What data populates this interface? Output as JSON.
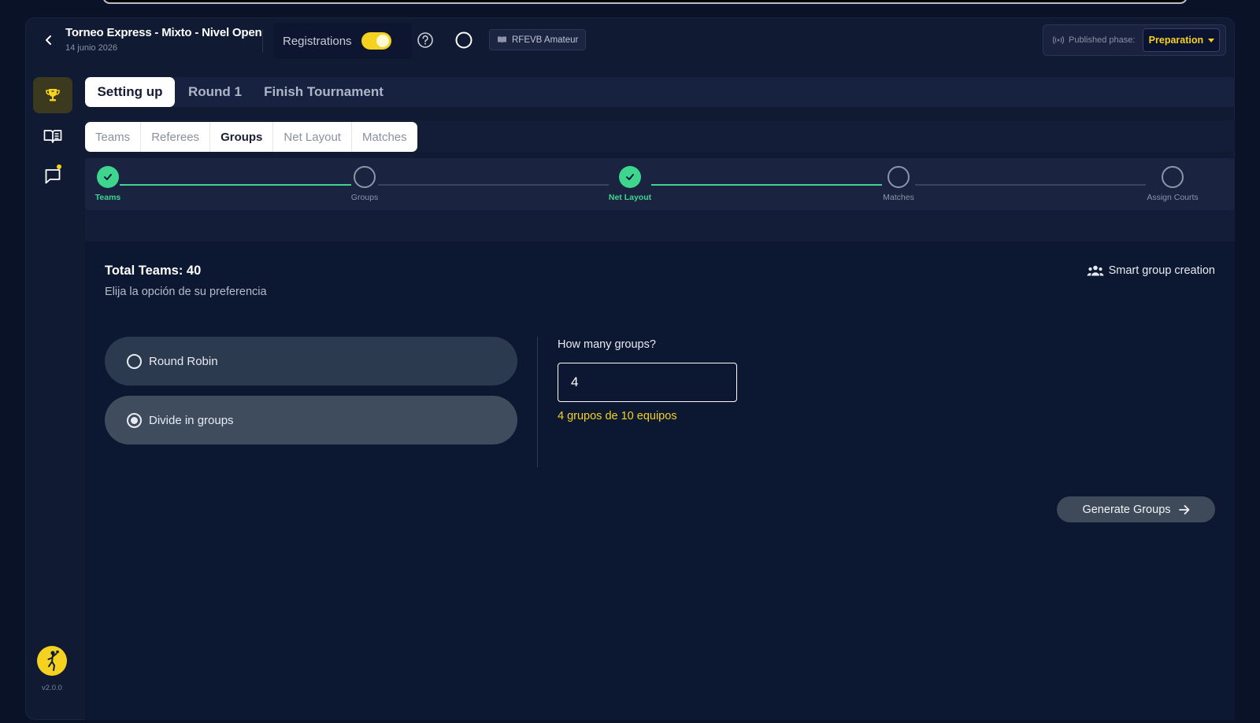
{
  "header": {
    "title": "Torneo Express - Mixto - Nivel Open",
    "date": "14 junio 2026",
    "registrations_label": "Registrations",
    "registrations_on": true,
    "level_badge": "RFEVB Amateur",
    "published_phase_label": "Published phase:",
    "published_phase_value": "Preparation"
  },
  "sidebar": {
    "items": [
      {
        "icon": "trophy-icon",
        "active": true
      },
      {
        "icon": "book-icon",
        "active": false
      },
      {
        "icon": "chat-icon",
        "active": false,
        "notification": true
      }
    ],
    "version": "v2.0.0"
  },
  "main_tabs": [
    {
      "label": "Setting up",
      "active": true
    },
    {
      "label": "Round 1",
      "active": false
    },
    {
      "label": "Finish Tournament",
      "active": false
    }
  ],
  "sub_tabs": [
    {
      "label": "Teams",
      "active": false
    },
    {
      "label": "Referees",
      "active": false
    },
    {
      "label": "Groups",
      "active": true
    },
    {
      "label": "Net Layout",
      "active": false
    },
    {
      "label": "Matches",
      "active": false
    }
  ],
  "stepper": [
    {
      "label": "Teams",
      "done": true
    },
    {
      "label": "Groups",
      "done": false
    },
    {
      "label": "Net Layout",
      "done": true
    },
    {
      "label": "Matches",
      "done": false
    },
    {
      "label": "Assign Courts",
      "done": false
    }
  ],
  "content": {
    "total_teams": "Total Teams: 40",
    "hint": "Elija la opción de su preferencia",
    "smart_group": "Smart group creation",
    "options": [
      {
        "label": "Round Robin",
        "selected": false
      },
      {
        "label": "Divide in groups",
        "selected": true
      }
    ],
    "groups_question": "How many groups?",
    "groups_value": "4",
    "groups_info": "4 grupos de 10 equipos",
    "generate_button": "Generate Groups"
  },
  "colors": {
    "accent": "#f4d21f",
    "success": "#3ed58f",
    "background": "#0a1228"
  }
}
